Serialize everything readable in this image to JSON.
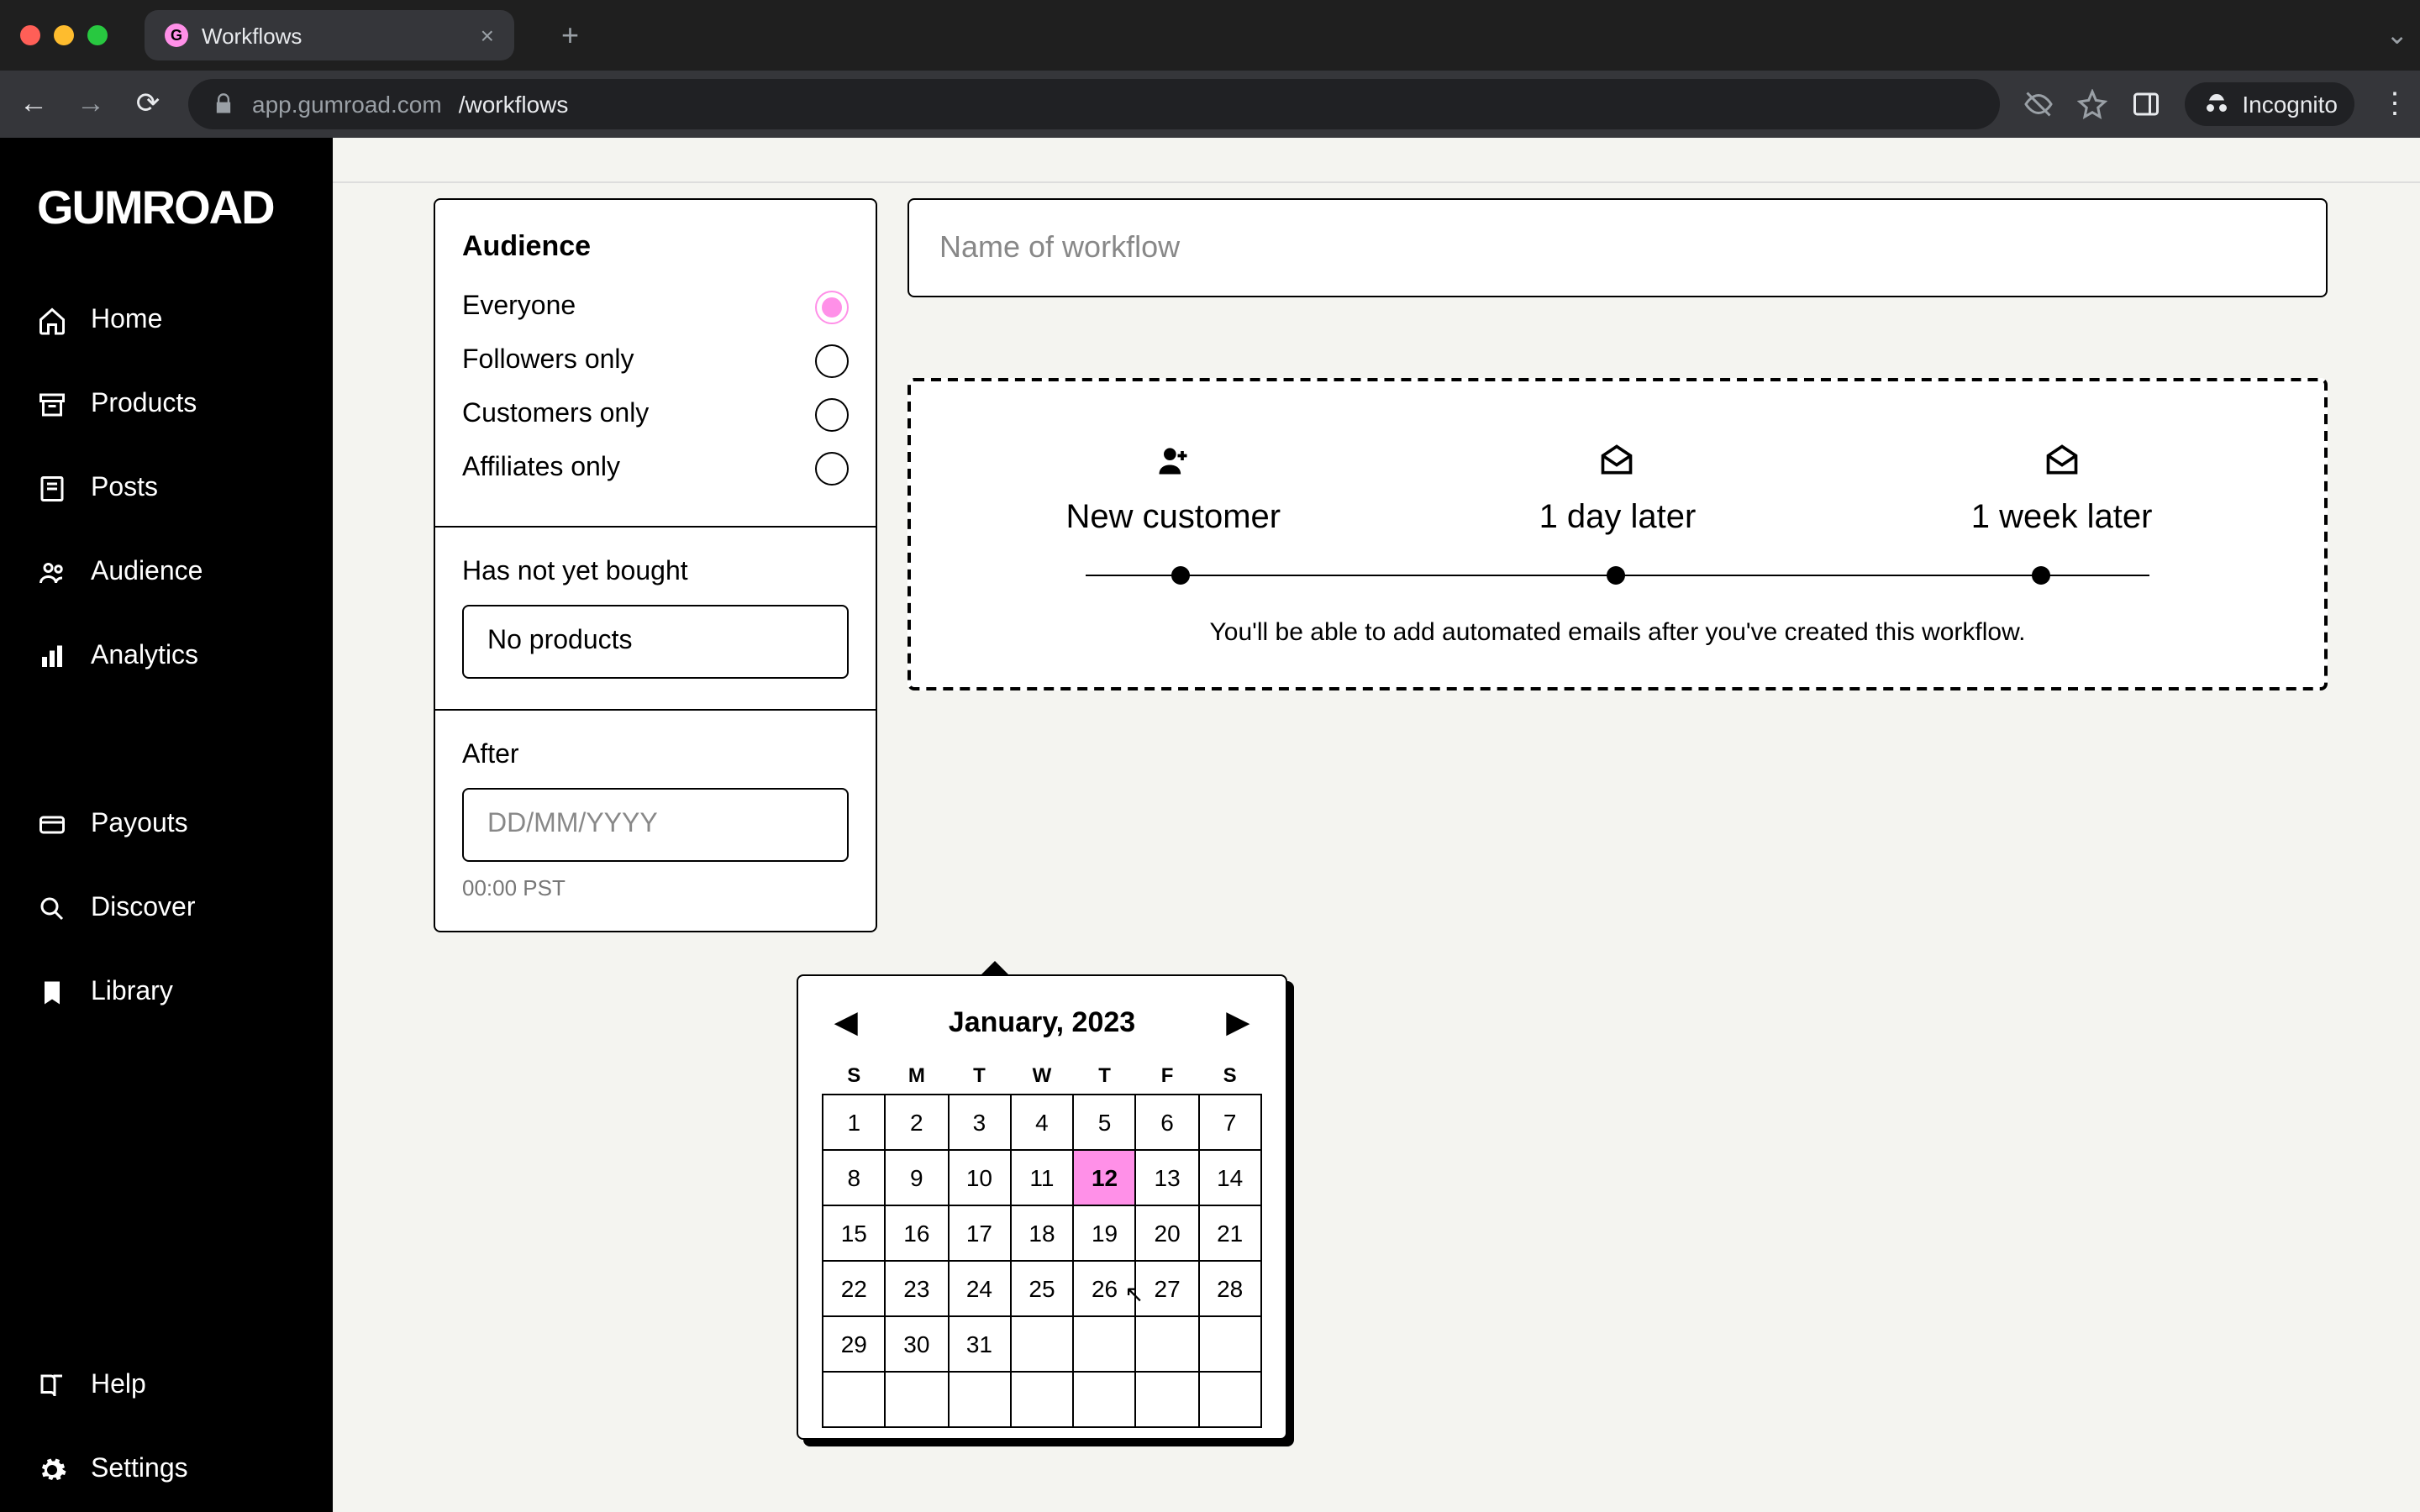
{
  "browser": {
    "tab_title": "Workflows",
    "url_host": "app.gumroad.com",
    "url_path": "/workflows",
    "incognito": "Incognito"
  },
  "sidebar": {
    "logo": "GUMROAD",
    "items": [
      {
        "label": "Home"
      },
      {
        "label": "Products"
      },
      {
        "label": "Posts"
      },
      {
        "label": "Audience"
      },
      {
        "label": "Analytics"
      }
    ],
    "items2": [
      {
        "label": "Payouts"
      },
      {
        "label": "Discover"
      },
      {
        "label": "Library"
      }
    ],
    "items3": [
      {
        "label": "Help"
      },
      {
        "label": "Settings"
      }
    ]
  },
  "panel": {
    "audience_heading": "Audience",
    "audience_options": [
      "Everyone",
      "Followers only",
      "Customers only",
      "Affiliates only"
    ],
    "audience_selected": 0,
    "bought_label": "Has not yet bought",
    "bought_value": "No products",
    "after_label": "After",
    "after_placeholder": "DD/MM/YYYY",
    "after_helper": "00:00 PST"
  },
  "main": {
    "name_placeholder": "Name of workflow",
    "steps": [
      "New customer",
      "1 day later",
      "1 week later"
    ],
    "hint": "You'll be able to add automated emails after you've created this workflow."
  },
  "calendar": {
    "title": "January, 2023",
    "dow": [
      "S",
      "M",
      "T",
      "W",
      "T",
      "F",
      "S"
    ],
    "weeks": [
      [
        "1",
        "2",
        "3",
        "4",
        "5",
        "6",
        "7"
      ],
      [
        "8",
        "9",
        "10",
        "11",
        "12",
        "13",
        "14"
      ],
      [
        "15",
        "16",
        "17",
        "18",
        "19",
        "20",
        "21"
      ],
      [
        "22",
        "23",
        "24",
        "25",
        "26",
        "27",
        "28"
      ],
      [
        "29",
        "30",
        "31",
        "",
        "",
        "",
        ""
      ],
      [
        "",
        "",
        "",
        "",
        "",
        "",
        ""
      ]
    ],
    "selected": "12"
  },
  "chart_data": null
}
